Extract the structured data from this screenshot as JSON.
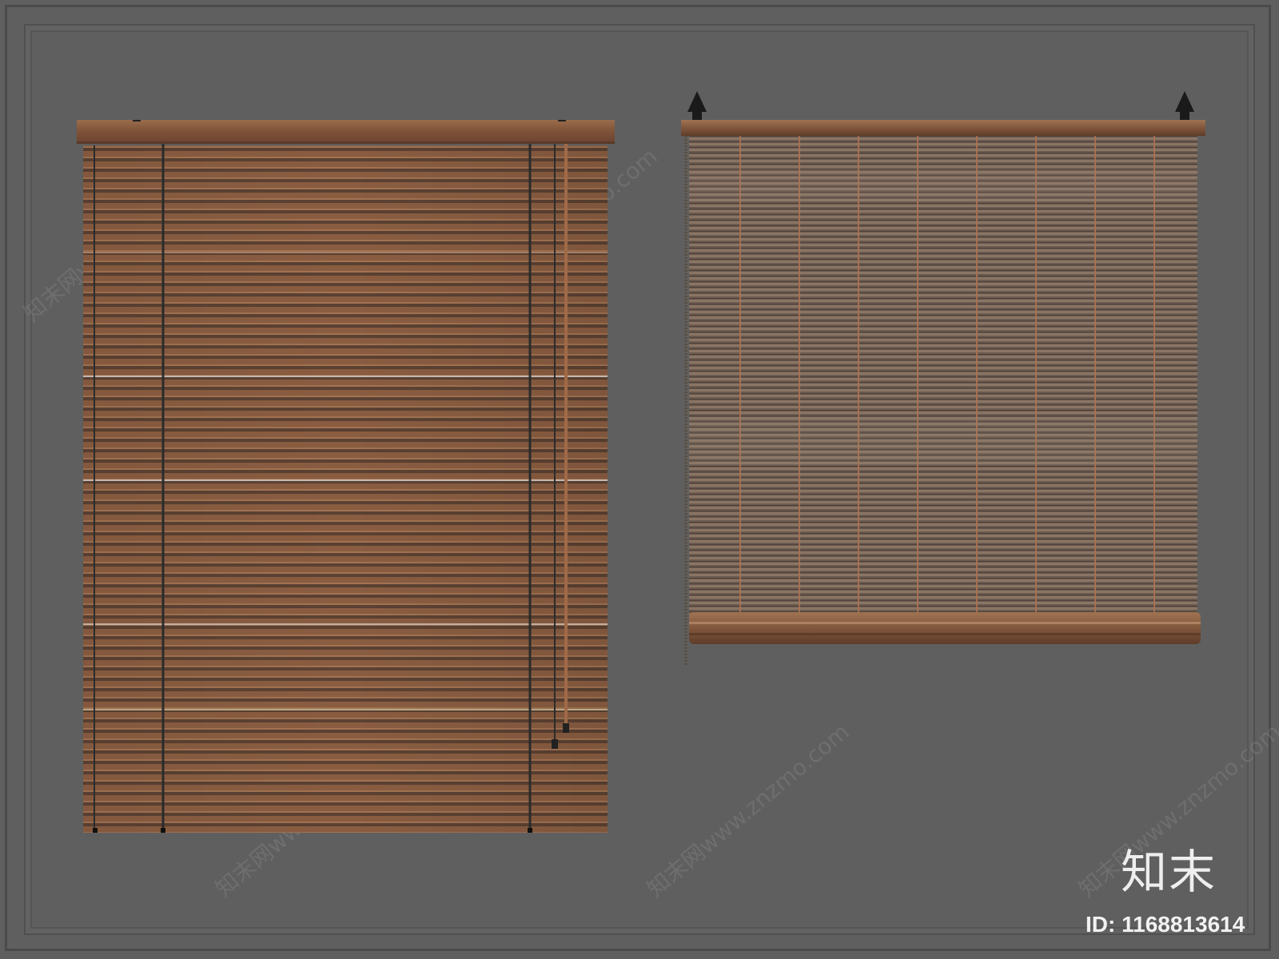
{
  "watermark": {
    "logo_text": "知末",
    "id_text": "ID: 1168813614",
    "site_text": "知末网www.znzmo.com"
  },
  "colors": {
    "background": "#5f5f5f",
    "wood_light": "#8a5e42",
    "wood_dark": "#5a3d2c",
    "cord": "#2b2b2b"
  },
  "objects": {
    "blind_left": "wooden-venetian-blind",
    "blind_right": "bamboo-roll-blind"
  }
}
